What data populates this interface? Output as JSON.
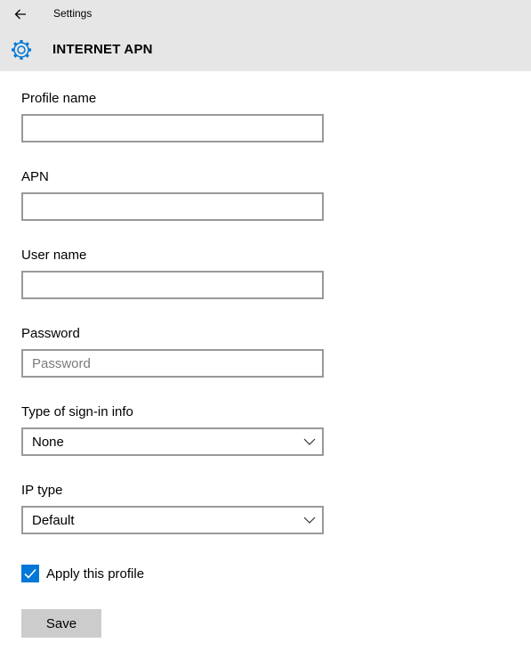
{
  "header": {
    "window_title": "Settings",
    "page_title": "INTERNET APN",
    "back_icon": "arrow-left-icon",
    "page_icon": "gear-icon",
    "accent_color": "#0078d7"
  },
  "form": {
    "profile_name": {
      "label": "Profile name",
      "value": "",
      "placeholder": ""
    },
    "apn": {
      "label": "APN",
      "value": "",
      "placeholder": ""
    },
    "user_name": {
      "label": "User name",
      "value": "",
      "placeholder": ""
    },
    "password": {
      "label": "Password",
      "value": "",
      "placeholder": "Password"
    },
    "sign_in_type": {
      "label": "Type of sign-in info",
      "selected": "None"
    },
    "ip_type": {
      "label": "IP type",
      "selected": "Default"
    },
    "apply_profile": {
      "label": "Apply this profile",
      "checked": true
    },
    "save_label": "Save"
  }
}
